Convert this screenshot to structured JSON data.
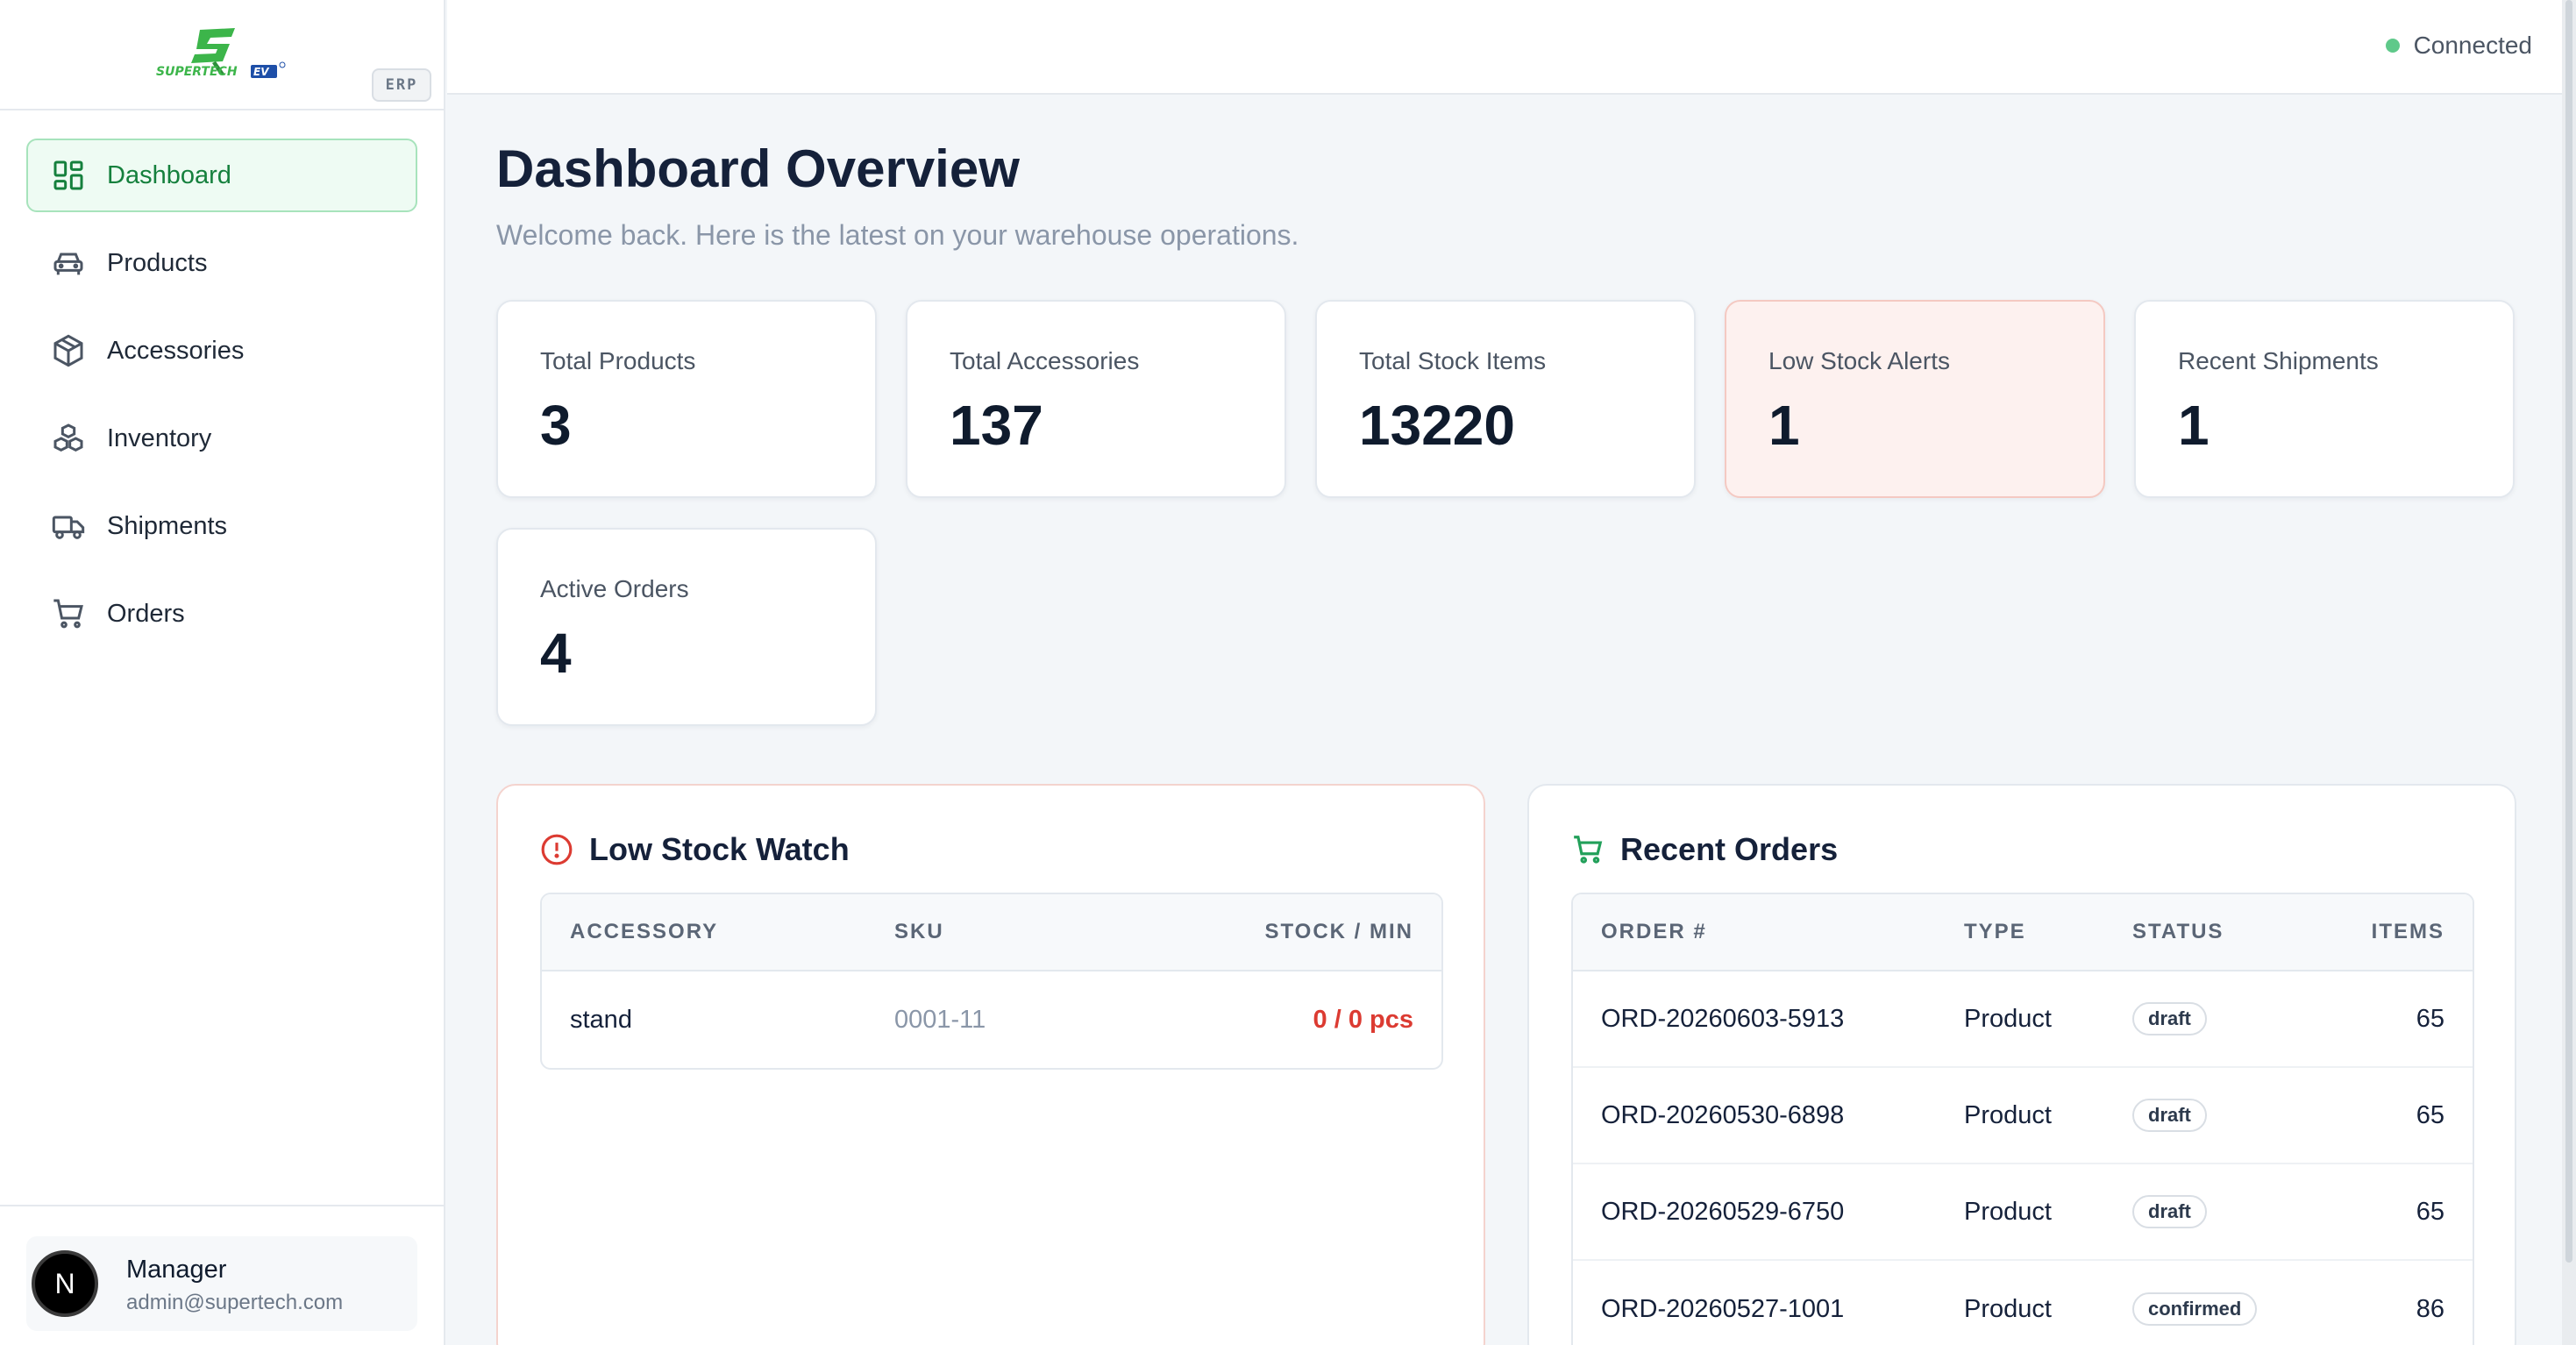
{
  "brand": {
    "logo_alt": "SUPERTECH EV",
    "badge": "ERP"
  },
  "sidebar": {
    "items": [
      {
        "label": "Dashboard",
        "icon": "dashboard-icon",
        "active": true
      },
      {
        "label": "Products",
        "icon": "car-icon"
      },
      {
        "label": "Accessories",
        "icon": "box-icon"
      },
      {
        "label": "Inventory",
        "icon": "boxes-icon"
      },
      {
        "label": "Shipments",
        "icon": "truck-icon"
      },
      {
        "label": "Orders",
        "icon": "cart-icon"
      }
    ]
  },
  "user": {
    "initial": "N",
    "name": "Manager",
    "email": "admin@supertech.com"
  },
  "topbar": {
    "status": "Connected",
    "status_color": "#5fc98a"
  },
  "page": {
    "title": "Dashboard Overview",
    "subtitle": "Welcome back. Here is the latest on your warehouse operations."
  },
  "stats": [
    {
      "label": "Total Products",
      "value": "3"
    },
    {
      "label": "Total Accessories",
      "value": "137"
    },
    {
      "label": "Total Stock Items",
      "value": "13220"
    },
    {
      "label": "Low Stock Alerts",
      "value": "1",
      "alert": true
    },
    {
      "label": "Recent Shipments",
      "value": "1"
    },
    {
      "label": "Active Orders",
      "value": "4"
    }
  ],
  "low_stock": {
    "title": "Low Stock Watch",
    "columns": [
      "ACCESSORY",
      "SKU",
      "STOCK / MIN"
    ],
    "rows": [
      {
        "accessory": "stand",
        "sku": "0001-11",
        "stock": "0 / 0 pcs"
      }
    ]
  },
  "recent_orders": {
    "title": "Recent Orders",
    "columns": [
      "ORDER #",
      "TYPE",
      "STATUS",
      "ITEMS"
    ],
    "rows": [
      {
        "order": "ORD-20260603-5913",
        "type": "Product",
        "status": "draft",
        "items": "65"
      },
      {
        "order": "ORD-20260530-6898",
        "type": "Product",
        "status": "draft",
        "items": "65"
      },
      {
        "order": "ORD-20260529-6750",
        "type": "Product",
        "status": "draft",
        "items": "65"
      },
      {
        "order": "ORD-20260527-1001",
        "type": "Product",
        "status": "confirmed",
        "items": "86"
      }
    ]
  },
  "colors": {
    "accent": "#15803d",
    "alert": "#dc3b32",
    "text": "#0f1b2d"
  }
}
